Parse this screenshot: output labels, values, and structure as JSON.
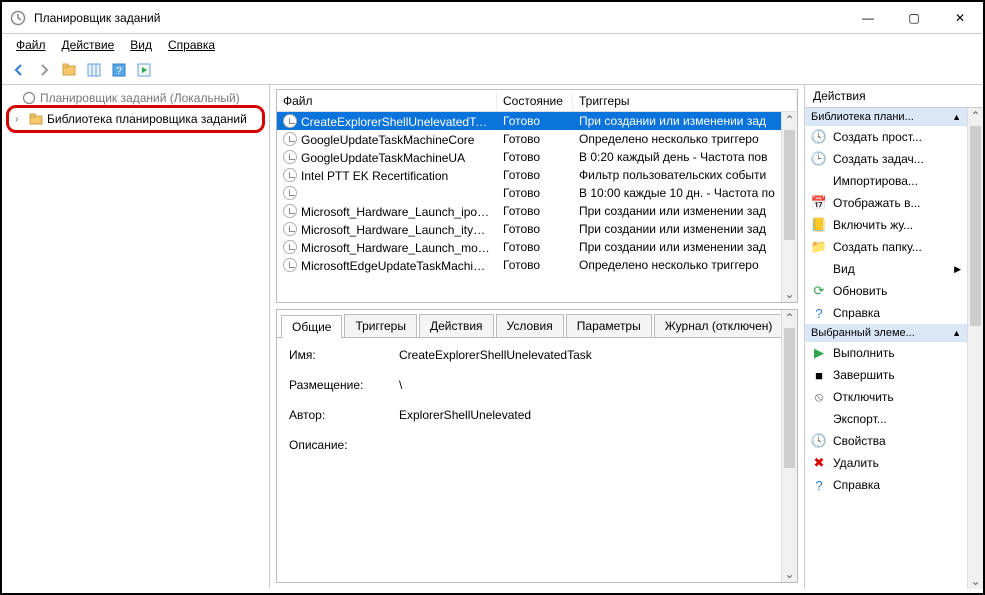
{
  "window": {
    "title": "Планировщик заданий"
  },
  "menu": {
    "file": "Файл",
    "action": "Действие",
    "view": "Вид",
    "help": "Справка"
  },
  "tree": {
    "root": "Планировщик заданий (Локальный)",
    "library": "Библиотека планировщика заданий"
  },
  "columns": {
    "file": "Файл",
    "state": "Состояние",
    "triggers": "Триггеры"
  },
  "tasks": [
    {
      "name": "CreateExplorerShellUnelevatedTask",
      "state": "Готово",
      "trigger": "При создании или изменении зад",
      "selected": true
    },
    {
      "name": "GoogleUpdateTaskMachineCore",
      "state": "Готово",
      "trigger": "Определено несколько триггеро"
    },
    {
      "name": "GoogleUpdateTaskMachineUA",
      "state": "Готово",
      "trigger": "В 0:20 каждый день - Частота пов"
    },
    {
      "name": "Intel PTT EK Recertification",
      "state": "Готово",
      "trigger": "Фильтр пользовательских событи"
    },
    {
      "name": "",
      "state": "Готово",
      "trigger": "В 10:00 каждые 10 дн. - Частота по"
    },
    {
      "name": "Microsoft_Hardware_Launch_ipoint_...",
      "state": "Готово",
      "trigger": "При создании или изменении зад"
    },
    {
      "name": "Microsoft_Hardware_Launch_itype_exe",
      "state": "Готово",
      "trigger": "При создании или изменении зад"
    },
    {
      "name": "Microsoft_Hardware_Launch_mouse...",
      "state": "Готово",
      "trigger": "При создании или изменении зад"
    },
    {
      "name": "MicrosoftEdgeUpdateTaskMachineC...",
      "state": "Готово",
      "trigger": "Определено несколько триггеро"
    }
  ],
  "detail_tabs": {
    "general": "Общие",
    "triggers": "Триггеры",
    "actions": "Действия",
    "conditions": "Условия",
    "settings": "Параметры",
    "history": "Журнал (отключен)"
  },
  "details": {
    "name_k": "Имя:",
    "name_v": "CreateExplorerShellUnelevatedTask",
    "location_k": "Размещение:",
    "location_v": "\\",
    "author_k": "Автор:",
    "author_v": "ExplorerShellUnelevated",
    "desc_k": "Описание:"
  },
  "actions": {
    "header": "Действия",
    "group1": "Библиотека плани...",
    "group2": "Выбранный элеме...",
    "items1": [
      {
        "label": "Создать прост...",
        "icon": "clock-plus"
      },
      {
        "label": "Создать задач...",
        "icon": "clock-new"
      },
      {
        "label": "Импортирова...",
        "icon": "none"
      },
      {
        "label": "Отображать в...",
        "icon": "calendar"
      },
      {
        "label": "Включить жу...",
        "icon": "journal"
      },
      {
        "label": "Создать папку...",
        "icon": "folder"
      },
      {
        "label": "Вид",
        "icon": "none",
        "arrow": true
      },
      {
        "label": "Обновить",
        "icon": "refresh"
      },
      {
        "label": "Справка",
        "icon": "help"
      }
    ],
    "items2": [
      {
        "label": "Выполнить",
        "icon": "play"
      },
      {
        "label": "Завершить",
        "icon": "stop"
      },
      {
        "label": "Отключить",
        "icon": "disable"
      },
      {
        "label": "Экспорт...",
        "icon": "none"
      },
      {
        "label": "Свойства",
        "icon": "clock"
      },
      {
        "label": "Удалить",
        "icon": "delete"
      },
      {
        "label": "Справка",
        "icon": "help"
      }
    ]
  }
}
